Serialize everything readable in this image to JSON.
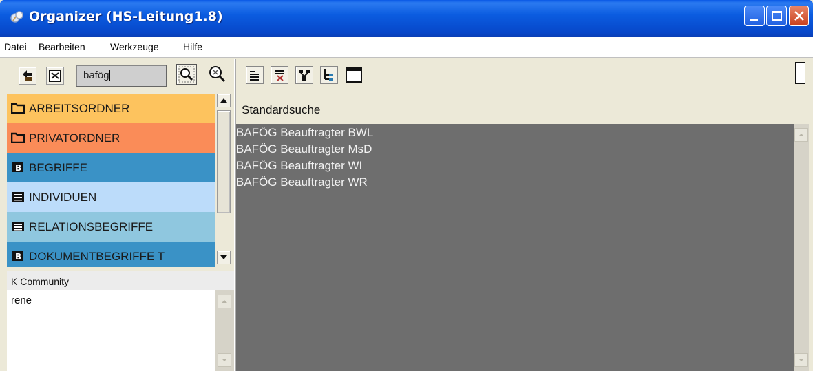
{
  "window": {
    "title": "Organizer (HS-Leitung1.8)",
    "accent": "#0a59e6"
  },
  "menu": {
    "items": [
      "Datei",
      "Bearbeiten",
      "Werkzeuge",
      "Hilfe"
    ]
  },
  "search": {
    "value": "bafög"
  },
  "folders": [
    {
      "label": "ARBEITSORDNER",
      "color": "#fdc35e",
      "icon": "folder-icon"
    },
    {
      "label": "PRIVATORDNER",
      "color": "#fa8c58",
      "icon": "folder-icon"
    },
    {
      "label": "BEGRIFFE",
      "color": "#3a92c6",
      "icon": "b-box-icon"
    },
    {
      "label": "INDIVIDUEN",
      "color": "#bcdcfa",
      "icon": "list-icon"
    },
    {
      "label": "RELATIONSBEGRIFFE",
      "color": "#8fc7df",
      "icon": "list-icon"
    },
    {
      "label": "DOKUMENTBEGRIFFE T",
      "color": "#3a92c6",
      "icon": "b-box-icon"
    }
  ],
  "community": {
    "header": "K Community",
    "entries": [
      "rene"
    ]
  },
  "main": {
    "section_label": "Standardsuche",
    "results": [
      "BAFÖG Beauftragter BWL",
      "BAFÖG Beauftragter MsD",
      "BAFÖG Beauftragter WI",
      "BAFÖG Beauftragter WR"
    ],
    "panel_color": "#6e6e6e"
  }
}
